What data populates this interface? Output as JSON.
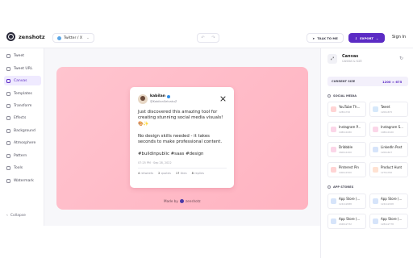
{
  "app": {
    "name": "zenshotz"
  },
  "toolbar": {
    "platform": "Twitter / X",
    "talk_label": "TALK TO ME",
    "export_label": "EXPORT",
    "signin_label": "Sign In"
  },
  "sidebar": {
    "items": [
      {
        "label": "Tweet",
        "icon": "tweet-icon"
      },
      {
        "label": "Tweet URL",
        "icon": "link-icon"
      },
      {
        "label": "Canvas",
        "icon": "canvas-icon",
        "active": true
      },
      {
        "label": "Templates",
        "icon": "templates-icon"
      },
      {
        "label": "Transform",
        "icon": "transform-icon"
      },
      {
        "label": "Effects",
        "icon": "effects-icon"
      },
      {
        "label": "Background",
        "icon": "background-icon"
      },
      {
        "label": "Atmosphere",
        "icon": "atmosphere-icon"
      },
      {
        "label": "Pattern",
        "icon": "pattern-icon"
      },
      {
        "label": "Tools",
        "icon": "tools-icon"
      },
      {
        "label": "Watermark",
        "icon": "watermark-icon"
      }
    ],
    "collapse_label": "Collapse"
  },
  "tweet": {
    "name": "kabilan",
    "handle": "@KabilanSelvakuZ",
    "body": "Just discovered this amazing tool for creating stunning social media visuals! 🎨✨\n\nNo design skills needed - it takes seconds to make professional content.\n\n#buildinpublic #saas #design",
    "meta": "07:25 PM · Sep 28, 2022",
    "stats": [
      {
        "count": "4",
        "label": "retweets"
      },
      {
        "count": "2",
        "label": "quotes"
      },
      {
        "count": "17",
        "label": "likes"
      },
      {
        "count": "8",
        "label": "replies"
      }
    ],
    "made_by": "Made by",
    "made_by_brand": "zenshotz"
  },
  "panel": {
    "title": "Canvas",
    "subtitle": "CANVAS & SIZE",
    "size_label": "CURRENT SIZE",
    "size_value": "1200 × 675",
    "social_header": "SOCIAL MEDIA",
    "app_header": "APP STORES",
    "social": [
      {
        "name": "YouTube Th...",
        "size": "1280x720",
        "color": "#ffd4d4"
      },
      {
        "name": "Tweet",
        "size": "1200x675",
        "color": "#d6e8fa"
      },
      {
        "name": "Instagram P...",
        "size": "1080x1080",
        "color": "#fbd6e8"
      },
      {
        "name": "Instagram S...",
        "size": "1080x1920",
        "color": "#fbd6e8"
      },
      {
        "name": "Dribbble",
        "size": "1600x1200",
        "color": "#fbd6e8"
      },
      {
        "name": "LinkedIn Post",
        "size": "1200x627",
        "color": "#d6e4fa"
      },
      {
        "name": "Pinterest Pin",
        "size": "1000x1500",
        "color": "#ffd4d4"
      },
      {
        "name": "Product Hunt",
        "size": "1270x760",
        "color": "#ffe2d2"
      }
    ],
    "stores": [
      {
        "name": "App Store (...",
        "size": "1242x2688",
        "color": "#d6e4fa"
      },
      {
        "name": "App Store (...",
        "size": "1242x2208",
        "color": "#d6e4fa"
      },
      {
        "name": "App Store (...",
        "size": "2048x2732",
        "color": "#d6e4fa"
      },
      {
        "name": "App Store (...",
        "size": "1284x2778",
        "color": "#d6e4fa"
      }
    ]
  }
}
